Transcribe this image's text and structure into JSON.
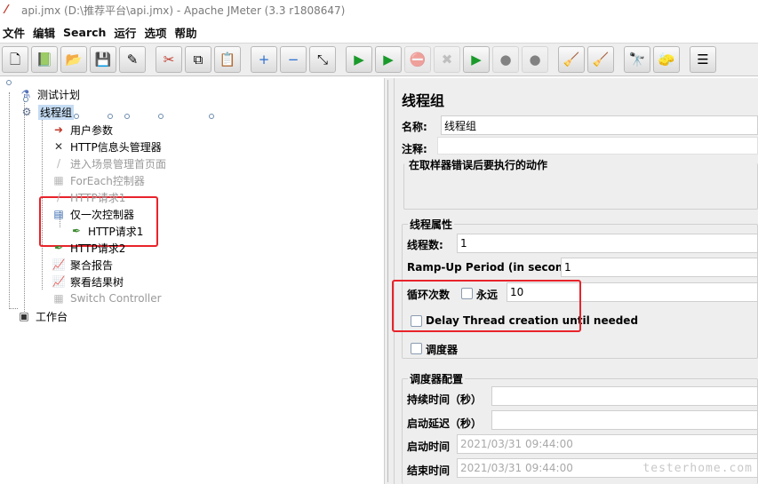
{
  "window": {
    "title": "api.jmx (D:\\推荐平台\\api.jmx) - Apache JMeter (3.3 r1808647)"
  },
  "menu": [
    "文件",
    "编辑",
    "Search",
    "运行",
    "选项",
    "帮助"
  ],
  "toolbar": {
    "buttons": [
      {
        "icon": "new-file-icon",
        "glyph": "🗋",
        "enabled": true
      },
      {
        "icon": "templates-icon",
        "glyph": "📗",
        "enabled": true
      },
      {
        "icon": "open-folder-icon",
        "glyph": "📂",
        "enabled": true
      },
      {
        "icon": "save-icon",
        "glyph": "💾",
        "enabled": true
      },
      {
        "icon": "save-as-icon",
        "glyph": "✎",
        "enabled": true
      },
      {
        "icon": "cut-icon",
        "glyph": "✂",
        "enabled": true
      },
      {
        "icon": "copy-icon",
        "glyph": "⧉",
        "enabled": true
      },
      {
        "icon": "paste-icon",
        "glyph": "📋",
        "enabled": true
      },
      {
        "icon": "expand-icon",
        "glyph": "+",
        "enabled": true
      },
      {
        "icon": "collapse-icon",
        "glyph": "−",
        "enabled": true
      },
      {
        "icon": "toggle-icon",
        "glyph": "⤡",
        "enabled": true
      },
      {
        "icon": "start-icon",
        "glyph": "▶",
        "enabled": true
      },
      {
        "icon": "start-no-pauses-icon",
        "glyph": "▶",
        "enabled": true
      },
      {
        "icon": "stop-icon",
        "glyph": "⛔",
        "enabled": false
      },
      {
        "icon": "shutdown-icon",
        "glyph": "✖",
        "enabled": false
      },
      {
        "icon": "remote-start-icon",
        "glyph": "▶",
        "enabled": true
      },
      {
        "icon": "remote-stop-icon",
        "glyph": "●",
        "enabled": false
      },
      {
        "icon": "remote-exit-icon",
        "glyph": "●",
        "enabled": false
      },
      {
        "icon": "clear-icon",
        "glyph": "🧹",
        "enabled": true
      },
      {
        "icon": "clear-all-icon",
        "glyph": "🧹",
        "enabled": true
      },
      {
        "icon": "search-icon",
        "glyph": "🔭",
        "enabled": true
      },
      {
        "icon": "reset-search-icon",
        "glyph": "🧽",
        "enabled": true
      },
      {
        "icon": "function-helper-icon",
        "glyph": "☰",
        "enabled": true
      }
    ]
  },
  "tree": {
    "nodes": [
      {
        "label": "测试计划",
        "icon": "test-plan-icon",
        "glyph": "⚗",
        "disabled": false,
        "selected": false
      },
      {
        "label": "线程组",
        "icon": "thread-group-icon",
        "glyph": "⚙",
        "disabled": false,
        "selected": true
      },
      {
        "label": "用户参数",
        "icon": "user-parameters-icon",
        "glyph": "➜",
        "disabled": false,
        "selected": false
      },
      {
        "label": "HTTP信息头管理器",
        "icon": "header-manager-icon",
        "glyph": "✕",
        "disabled": false,
        "selected": false
      },
      {
        "label": "进入场景管理首页面",
        "icon": "sampler-disabled-icon",
        "glyph": "/",
        "disabled": true,
        "selected": false
      },
      {
        "label": "ForEach控制器",
        "icon": "foreach-controller-icon",
        "glyph": "▦",
        "disabled": true,
        "selected": false
      },
      {
        "label": "HTTP请求1",
        "icon": "http-sampler-disabled-icon",
        "glyph": "/",
        "disabled": true,
        "selected": false
      },
      {
        "label": "仅一次控制器",
        "icon": "once-only-controller-icon",
        "glyph": "▤",
        "disabled": false,
        "selected": false
      },
      {
        "label": "HTTP请求1",
        "icon": "http-sampler-icon",
        "glyph": "✒",
        "disabled": false,
        "selected": false
      },
      {
        "label": "HTTP请求2",
        "icon": "http-sampler-icon",
        "glyph": "✒",
        "disabled": false,
        "selected": false
      },
      {
        "label": "聚合报告",
        "icon": "aggregate-report-icon",
        "glyph": "📈",
        "disabled": false,
        "selected": false
      },
      {
        "label": "察看结果树",
        "icon": "view-results-tree-icon",
        "glyph": "📈",
        "disabled": false,
        "selected": false
      },
      {
        "label": "Switch Controller",
        "icon": "switch-controller-icon",
        "glyph": "▦",
        "disabled": true,
        "selected": false
      },
      {
        "label": "工作台",
        "icon": "workbench-icon",
        "glyph": "▣",
        "disabled": false,
        "selected": false
      }
    ]
  },
  "panel": {
    "title": "线程组",
    "name_label": "名称:",
    "name_value": "线程组",
    "comment_label": "注释:",
    "comment_value": "",
    "on_error_title": "在取样器错误后要执行的动作",
    "thread_props_title": "线程属性",
    "threads_label": "线程数:",
    "threads_value": "1",
    "rampup_label": "Ramp-Up Period (in seconds):",
    "rampup_value": "1",
    "loop_label": "循环次数",
    "forever_label": "永远",
    "loop_value": "10",
    "delay_label": "Delay Thread creation until needed",
    "scheduler_label": "调度器",
    "scheduler_config_title": "调度器配置",
    "duration_label": "持续时间（秒）",
    "duration_value": "",
    "startup_delay_label": "启动延迟（秒）",
    "startup_delay_value": "",
    "start_time_label": "启动时间",
    "start_time_value": "2021/03/31 09:44:00",
    "end_time_label": "结束时间",
    "end_time_value": "2021/03/31 09:44:00"
  },
  "watermark": "testerhome.com",
  "colors": {
    "highlight": "#e8232a",
    "selection": "#c5dcf3"
  }
}
